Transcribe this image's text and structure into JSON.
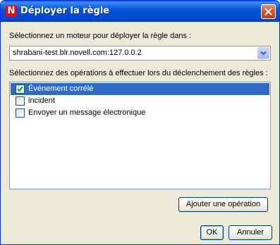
{
  "window": {
    "title": "Déployer la règle",
    "app_icon_letter": "N",
    "app_icon_color": "#d8101a",
    "close_icon": "close-icon"
  },
  "engine": {
    "label": "Sélectionnez un moteur pour déployer la règle dans :",
    "selected_value": "shrabani-test.blr.novell.com:127.0.0.2",
    "dropdown_icon": "chevron-down-icon"
  },
  "operations": {
    "label": "Sélectionnez des opérations à effectuer lors du déclenchement des règles :",
    "items": [
      {
        "label": "Événement corrélé",
        "checked": true,
        "selected": true
      },
      {
        "label": "incident",
        "checked": false,
        "selected": false
      },
      {
        "label": "Envoyer un message électronique",
        "checked": false,
        "selected": false
      }
    ],
    "selection_color": "#316ac5"
  },
  "buttons": {
    "add_operation": "Ajouter une opération",
    "ok": "OK",
    "cancel": "Annuler"
  }
}
